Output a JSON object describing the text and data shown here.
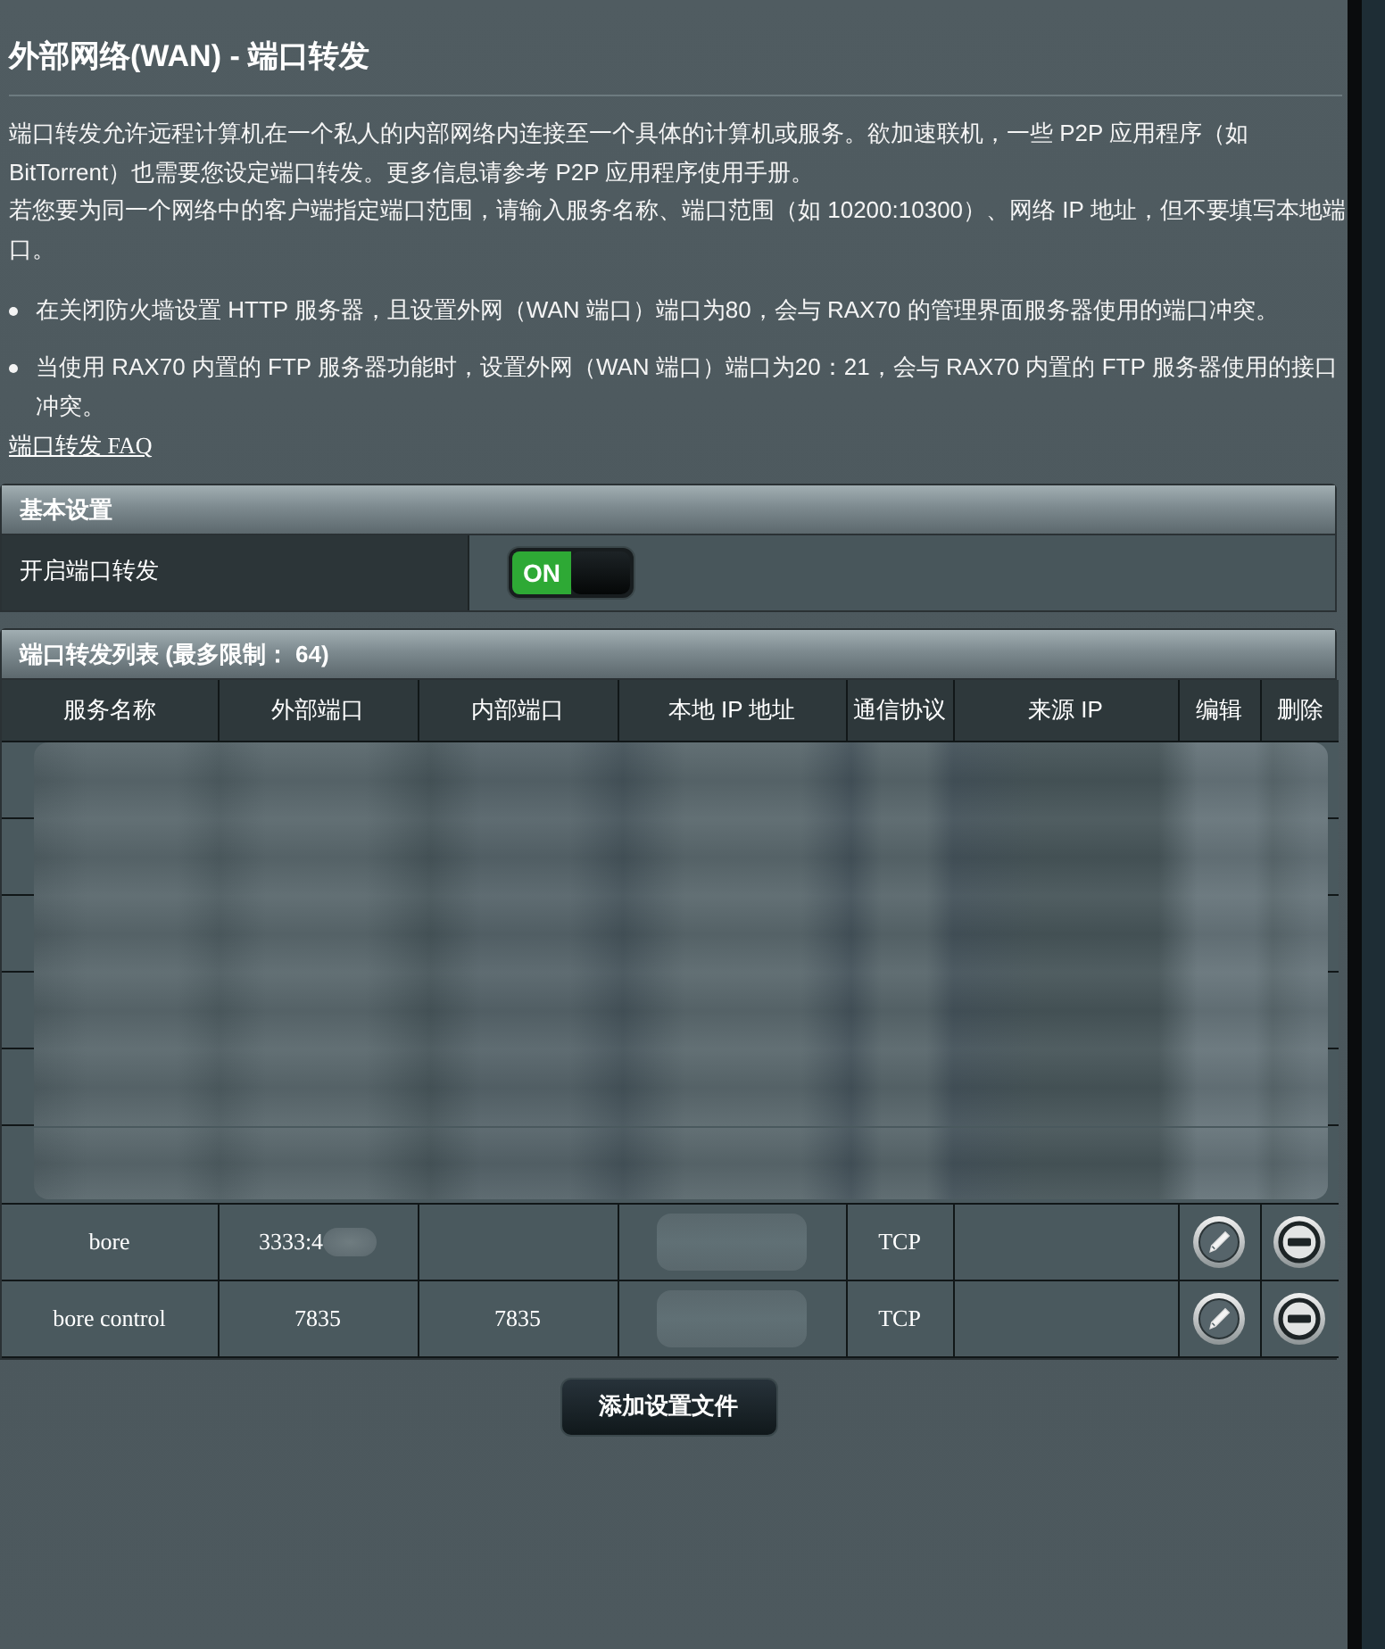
{
  "page": {
    "title": "外部网络(WAN) - 端口转发"
  },
  "intro": {
    "paragraphs": [
      "端口转发允许远程计算机在一个私人的内部网络内连接至一个具体的计算机或服务。欲加速联机，一些 P2P 应用程序（如 BitTorrent）也需要您设定端口转发。更多信息请参考 P2P 应用程序使用手册。",
      "若您要为同一个网络中的客户端指定端口范围，请输入服务名称、端口范围（如 10200:10300）、网络 IP 地址，但不要填写本地端口。"
    ],
    "notes": [
      "在关闭防火墙设置 HTTP 服务器，且设置外网（WAN 端口）端口为80，会与 RAX70 的管理界面服务器使用的端口冲突。",
      "当使用 RAX70 内置的 FTP 服务器功能时，设置外网（WAN 端口）端口为20：21，会与 RAX70 内置的 FTP 服务器使用的接口冲突。"
    ],
    "faq_link": "端口转发 FAQ"
  },
  "basic_settings": {
    "title": "基本设置",
    "rows": [
      {
        "label": "开启端口转发",
        "kind": "toggle",
        "on": true,
        "text": "ON"
      }
    ]
  },
  "port_list": {
    "title": "端口转发列表 (最多限制： 64)",
    "columns": [
      "服务名称",
      "外部端口",
      "内部端口",
      "本地 IP 地址",
      "通信协议",
      "来源 IP",
      "编辑",
      "删除"
    ],
    "rows": [
      {
        "redacted": true
      },
      {
        "redacted": true
      },
      {
        "redacted": true
      },
      {
        "redacted": true
      },
      {
        "redacted": true
      },
      {
        "redacted": true
      },
      {
        "redacted": false,
        "service_name": "bore",
        "external_port": "3333:4",
        "external_port_tail_redacted": true,
        "local_ip_redacted": true,
        "protocol": "TCP"
      },
      {
        "redacted": false,
        "service_name": "bore control",
        "external_port": "7835",
        "external_port_tail_redacted": false,
        "internal_port": "7835",
        "local_ip_redacted": true,
        "protocol": "TCP"
      }
    ]
  },
  "add_button": {
    "label": "添加设置文件"
  }
}
